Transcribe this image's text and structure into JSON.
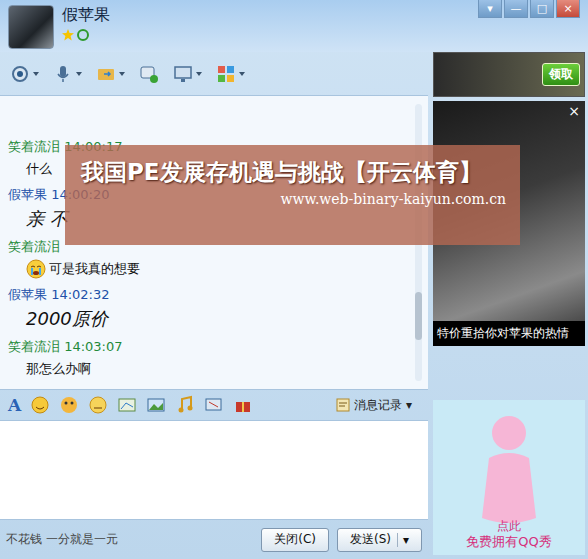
{
  "window": {
    "title": "假苹果",
    "controls": [
      "▾",
      "—",
      "□",
      "×"
    ]
  },
  "messages": [
    {
      "sender": "笑着流泪",
      "time": "14:00:17",
      "text": "什么",
      "kind": "friend",
      "italic": false,
      "emoji": false
    },
    {
      "sender": "假苹果",
      "time": "14:00:20",
      "text": "亲 不",
      "kind": "self",
      "italic": true,
      "emoji": false
    },
    {
      "sender": "笑着流泪",
      "time": "",
      "text": "可是我真的想要",
      "kind": "friend",
      "italic": false,
      "emoji": true
    },
    {
      "sender": "假苹果",
      "time": "14:02:32",
      "text": "2000原价",
      "kind": "self",
      "italic": true,
      "emoji": false
    },
    {
      "sender": "笑着流泪",
      "time": "14:03:07",
      "text": "那怎么办啊",
      "kind": "friend",
      "italic": false,
      "emoji": false
    }
  ],
  "scrollbar": {
    "level": 0.82
  },
  "input_toolbar": {
    "font_button": "A",
    "history": "消息记录",
    "history_arrow": "▾"
  },
  "status_bar": {
    "text": "不花钱 一分就是一元"
  },
  "buttons": [
    {
      "label": "关闭(C)",
      "primary": false
    },
    {
      "label": "发送(S)",
      "primary": true,
      "arrow": "▾"
    }
  ],
  "ad": {
    "claim": "领取",
    "close": "×",
    "caption": "特价重拾你对苹果的热情"
  },
  "qq_show": {
    "line1": "点此",
    "line2": "免费拥有QQ秀"
  },
  "overlay": {
    "title": "我国PE发展存机遇与挑战【开云体育】",
    "url": "www.web-binary-kaiyun.com.cn"
  }
}
